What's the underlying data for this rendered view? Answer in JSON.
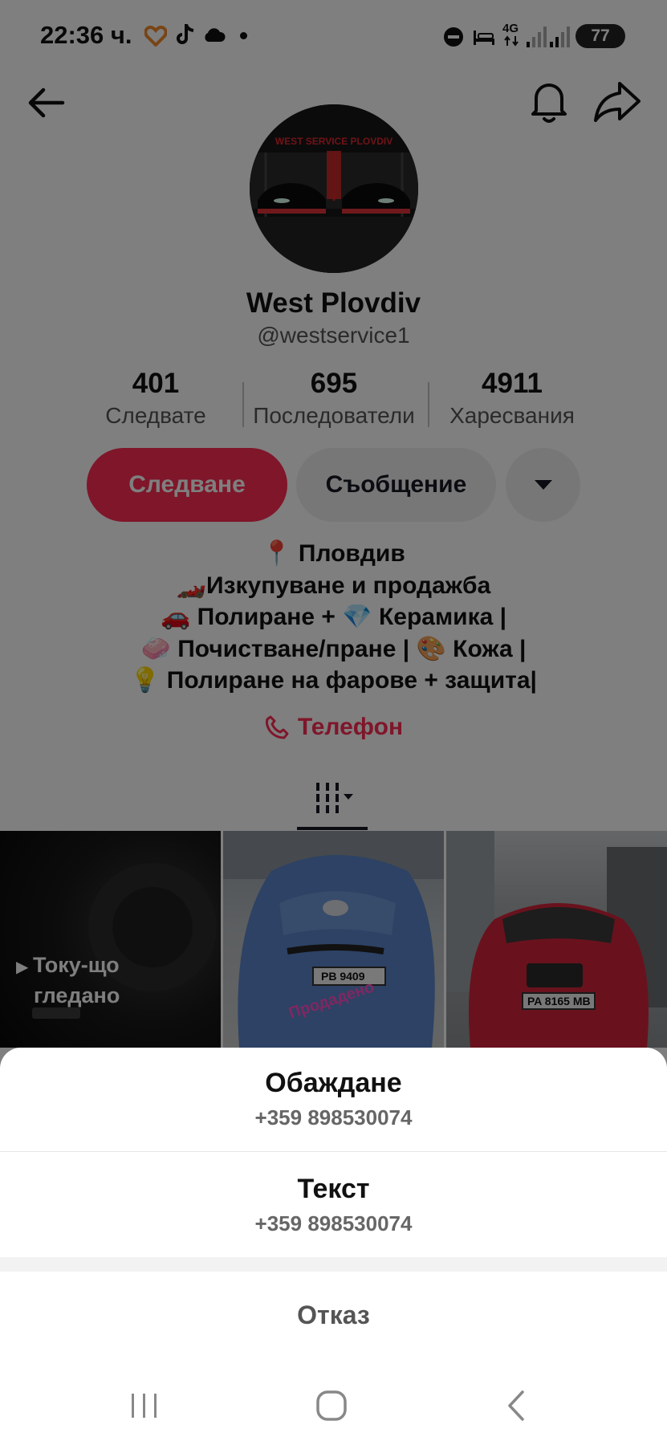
{
  "status_bar": {
    "time": "22:36 ч.",
    "battery": "77",
    "network": "4G"
  },
  "profile": {
    "avatar_text": "WEST SERVICE PLOVDIV",
    "name": "West Plovdiv",
    "handle": "@westservice1",
    "stats": [
      {
        "value": "401",
        "label": "Следвате"
      },
      {
        "value": "695",
        "label": "Последователи"
      },
      {
        "value": "4911",
        "label": "Харесвания"
      }
    ],
    "follow_label": "Следване",
    "message_label": "Съобщение",
    "bio": [
      "📍 Пловдив",
      "🏎️Изкупуване и продажба",
      "🚗 Полиране + 💎 Керамика |",
      "🧼 Почистване/пране | 🎨 Кожа |",
      "💡 Полиране на фарове + защита|"
    ],
    "phone_link": "Телефон"
  },
  "videos": {
    "watched_label_1": "Току-що",
    "watched_label_2": "гледано",
    "plate_2": "PB 9409",
    "sold_tag": "Продадено",
    "plate_3": "PA 8165 MB"
  },
  "sheet": {
    "call_label": "Обаждане",
    "call_number": "+359 898530074",
    "text_label": "Текст",
    "text_number": "+359 898530074",
    "cancel_label": "Отказ"
  },
  "colors": {
    "accent": "#fe2c55",
    "overlay": "rgba(0,0,0,0.5)"
  }
}
